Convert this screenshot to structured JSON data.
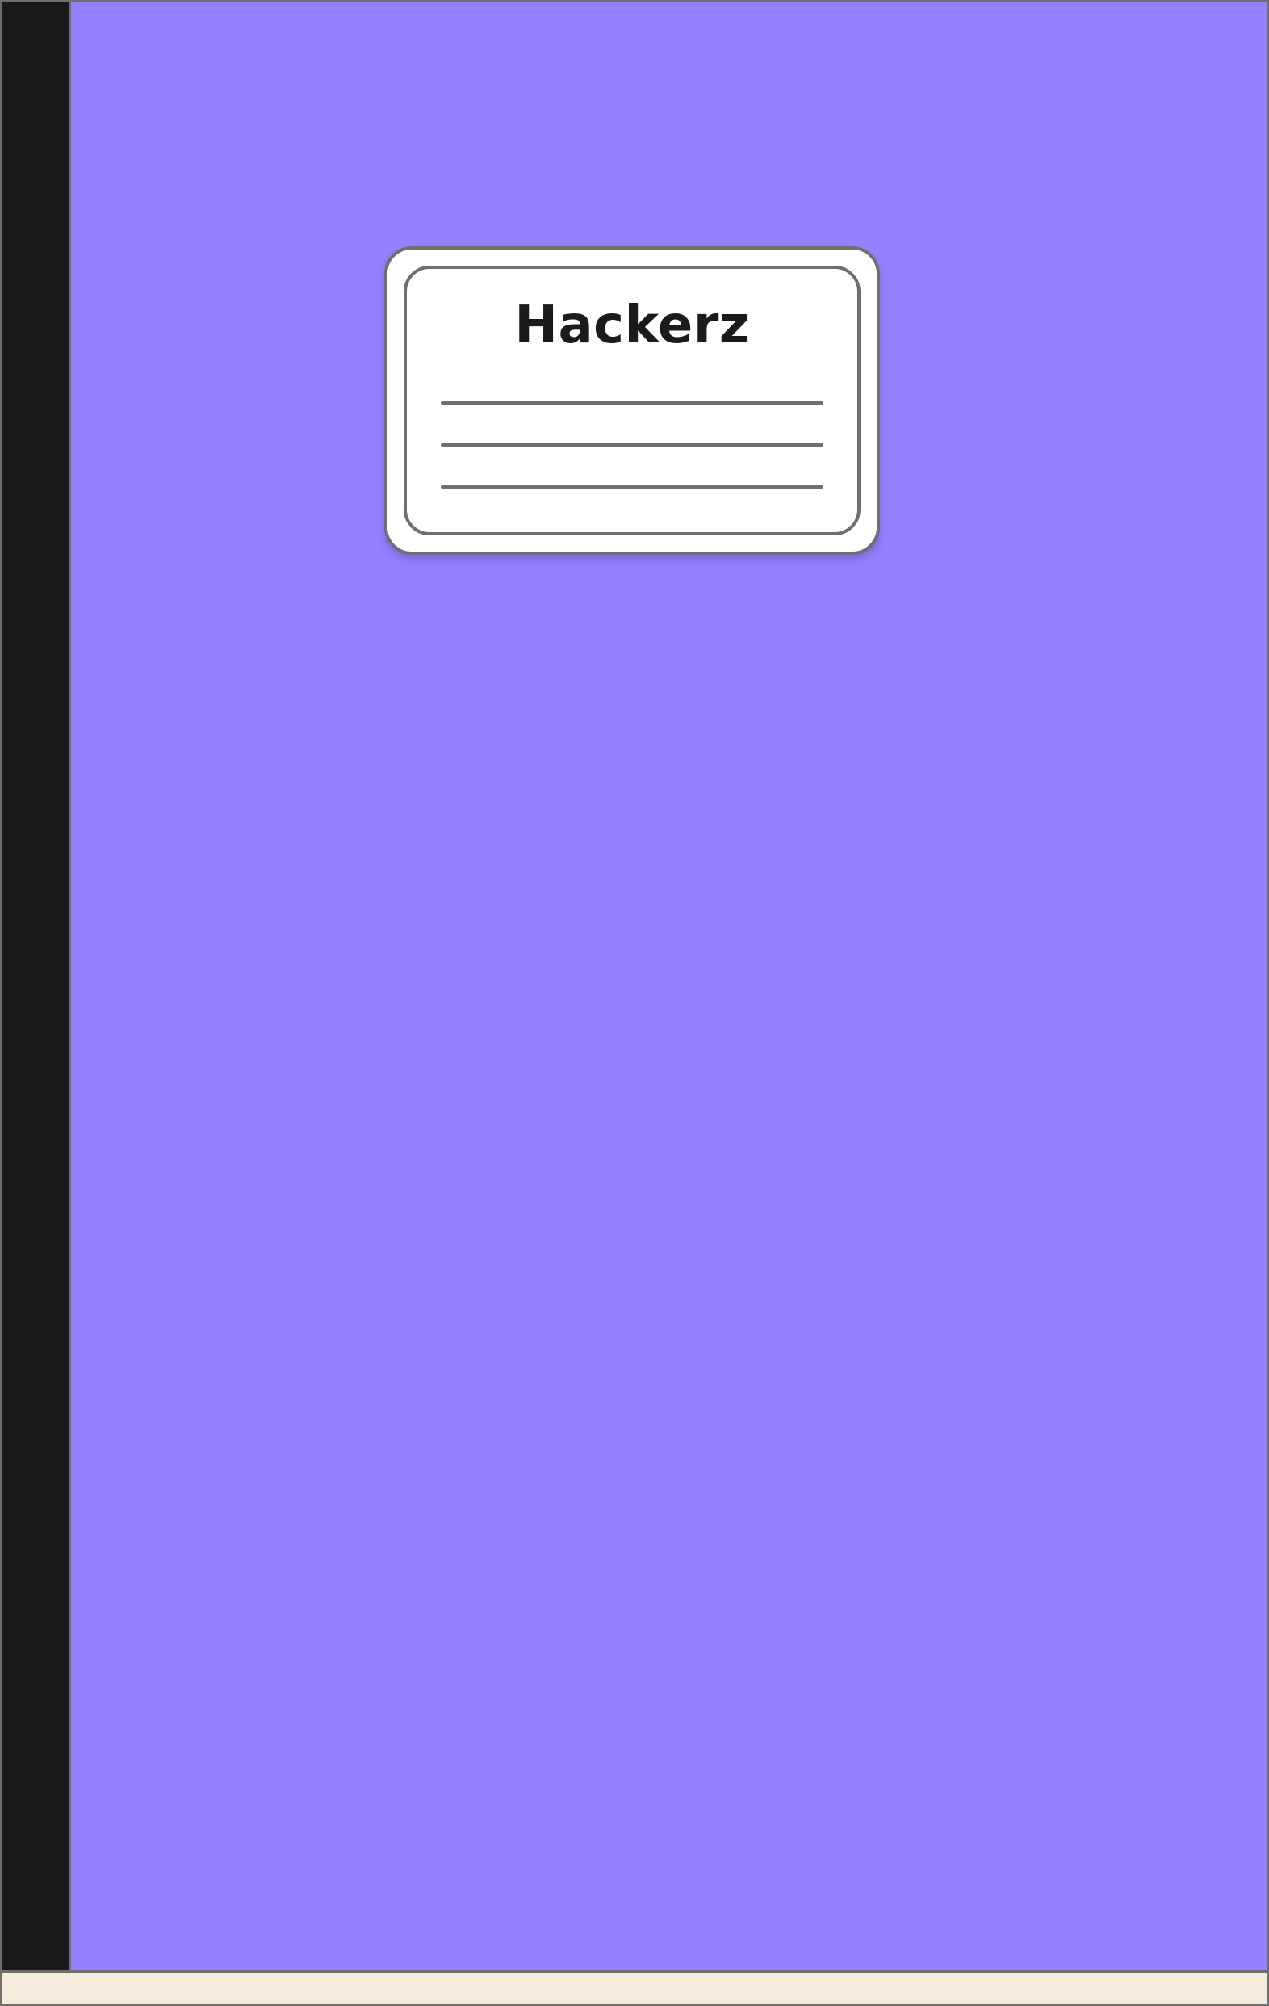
{
  "notebook": {
    "title": "Hackerz",
    "colors": {
      "cover": "#9580ff",
      "spine": "#1b1b1b",
      "label": "#ffffff",
      "outline": "#6f6f6f",
      "pages": "#f7ecdc"
    }
  }
}
